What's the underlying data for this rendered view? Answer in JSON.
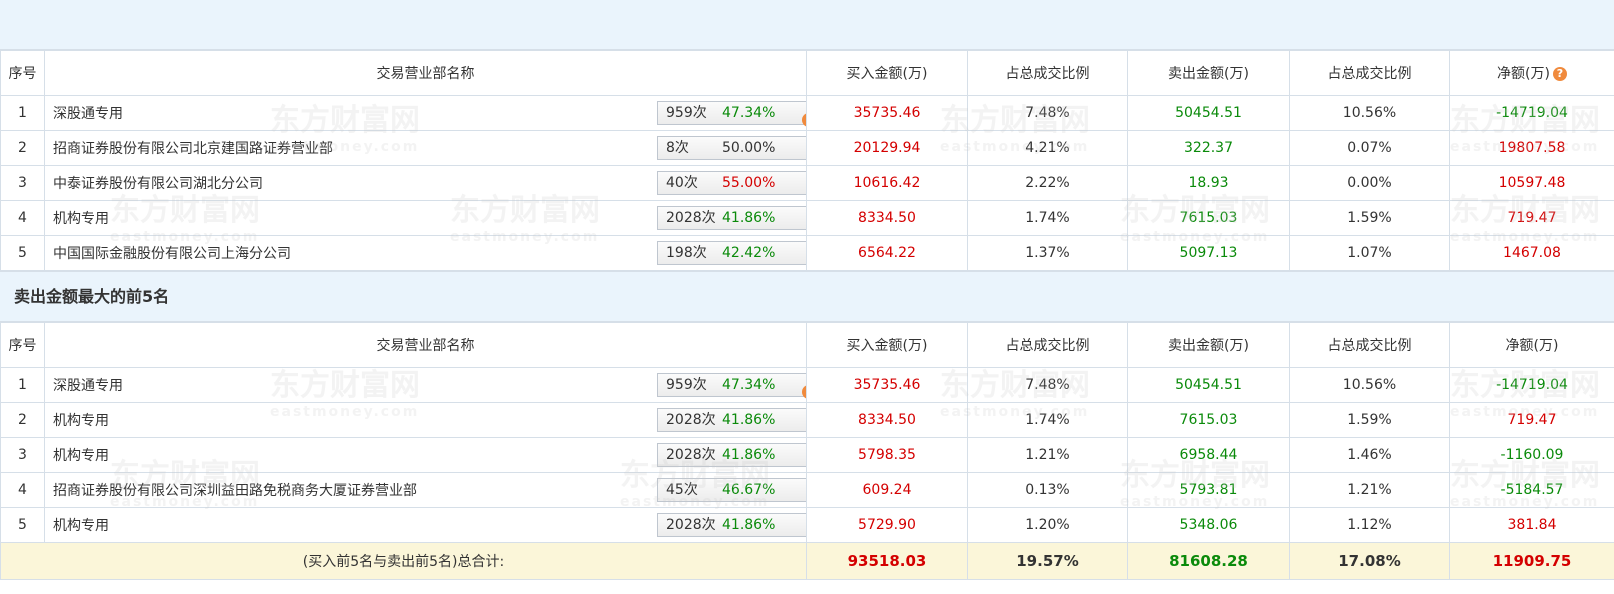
{
  "top_table": {
    "headers": {
      "rank": "序号",
      "name": "交易营业部名称",
      "buy": "买入金额(万)",
      "buy_pct": "占总成交比例",
      "sell": "卖出金额(万)",
      "sell_pct": "占总成交比例",
      "net": "净额(万)"
    },
    "rows": [
      {
        "rank": "1",
        "name": "深股通专用",
        "count": "959次",
        "pct": "47.34%",
        "pct_color": "green",
        "control": "help-icon",
        "buy": "35735.46",
        "buy_pct": "7.48%",
        "sell": "50454.51",
        "sell_pct": "10.56%",
        "net": "-14719.04",
        "net_color": "green"
      },
      {
        "rank": "2",
        "name": "招商证券股份有限公司北京建国路证券营业部",
        "count": "8次",
        "pct": "50.00%",
        "pct_color": "black",
        "control": "play-arrow-icon",
        "buy": "20129.94",
        "buy_pct": "4.21%",
        "sell": "322.37",
        "sell_pct": "0.07%",
        "net": "19807.58",
        "net_color": "red"
      },
      {
        "rank": "3",
        "name": "中泰证券股份有限公司湖北分公司",
        "count": "40次",
        "pct": "55.00%",
        "pct_color": "red",
        "control": "play-arrow-icon",
        "buy": "10616.42",
        "buy_pct": "2.22%",
        "sell": "18.93",
        "sell_pct": "0.00%",
        "net": "10597.48",
        "net_color": "red"
      },
      {
        "rank": "4",
        "name": "机构专用",
        "count": "2028次",
        "pct": "41.86%",
        "pct_color": "green",
        "control": "play-arrow-icon",
        "buy": "8334.50",
        "buy_pct": "1.74%",
        "sell": "7615.03",
        "sell_pct": "1.59%",
        "net": "719.47",
        "net_color": "red"
      },
      {
        "rank": "5",
        "name": "中国国际金融股份有限公司上海分公司",
        "count": "198次",
        "pct": "42.42%",
        "pct_color": "green",
        "control": "play-arrow-icon",
        "buy": "6564.22",
        "buy_pct": "1.37%",
        "sell": "5097.13",
        "sell_pct": "1.07%",
        "net": "1467.08",
        "net_color": "red"
      }
    ]
  },
  "sell_section_title": "卖出金额最大的前5名",
  "bottom_table": {
    "headers": {
      "rank": "序号",
      "name": "交易营业部名称",
      "buy": "买入金额(万)",
      "buy_pct": "占总成交比例",
      "sell": "卖出金额(万)",
      "sell_pct": "占总成交比例",
      "net": "净额(万)"
    },
    "rows": [
      {
        "rank": "1",
        "name": "深股通专用",
        "count": "959次",
        "pct": "47.34%",
        "pct_color": "green",
        "control": "help-icon",
        "buy": "35735.46",
        "buy_pct": "7.48%",
        "sell": "50454.51",
        "sell_pct": "10.56%",
        "net": "-14719.04",
        "net_color": "green"
      },
      {
        "rank": "2",
        "name": "机构专用",
        "count": "2028次",
        "pct": "41.86%",
        "pct_color": "green",
        "control": "play-arrow-icon",
        "buy": "8334.50",
        "buy_pct": "1.74%",
        "sell": "7615.03",
        "sell_pct": "1.59%",
        "net": "719.47",
        "net_color": "red"
      },
      {
        "rank": "3",
        "name": "机构专用",
        "count": "2028次",
        "pct": "41.86%",
        "pct_color": "green",
        "control": "play-arrow-icon",
        "buy": "5798.35",
        "buy_pct": "1.21%",
        "sell": "6958.44",
        "sell_pct": "1.46%",
        "net": "-1160.09",
        "net_color": "green"
      },
      {
        "rank": "4",
        "name": "招商证券股份有限公司深圳益田路免税商务大厦证券营业部",
        "count": "45次",
        "pct": "46.67%",
        "pct_color": "green",
        "control": "play-arrow-icon",
        "buy": "609.24",
        "buy_pct": "0.13%",
        "sell": "5793.81",
        "sell_pct": "1.21%",
        "net": "-5184.57",
        "net_color": "green"
      },
      {
        "rank": "5",
        "name": "机构专用",
        "count": "2028次",
        "pct": "41.86%",
        "pct_color": "green",
        "control": "play-arrow-icon",
        "buy": "5729.90",
        "buy_pct": "1.20%",
        "sell": "5348.06",
        "sell_pct": "1.12%",
        "net": "381.84",
        "net_color": "red"
      }
    ],
    "total": {
      "label": "(买入前5名与卖出前5名)总合计:",
      "buy": "93518.03",
      "buy_pct": "19.57%",
      "sell": "81608.28",
      "sell_pct": "17.08%",
      "net": "11909.75"
    }
  },
  "watermark": {
    "cn": "东方财富网",
    "en": "eastmoney.com"
  },
  "colors": {
    "header_bg": "#eaf4fc",
    "total_bg": "#fbf6d9",
    "buy_red": "#d40000",
    "sell_green": "#0a8a0a",
    "help_orange": "#f08a3c",
    "arrow_blue": "#1d5aa0"
  }
}
